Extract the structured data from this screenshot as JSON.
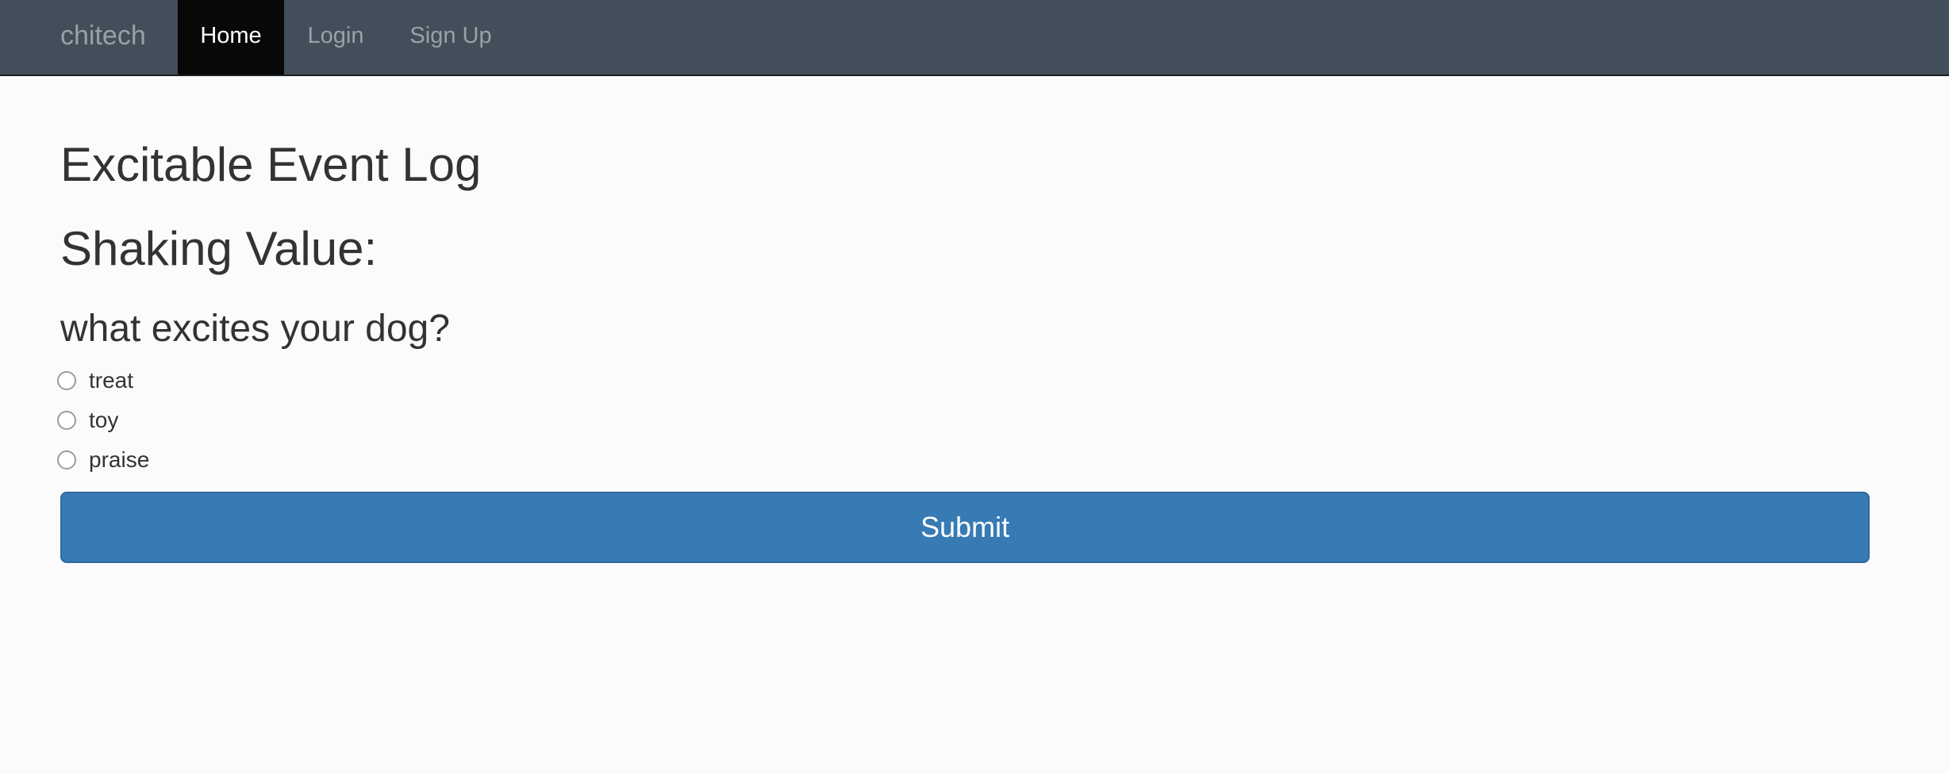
{
  "navbar": {
    "brand": "chitech",
    "items": [
      {
        "label": "Home",
        "active": true
      },
      {
        "label": "Login",
        "active": false
      },
      {
        "label": "Sign Up",
        "active": false
      }
    ]
  },
  "main": {
    "title": "Excitable Event Log",
    "shaking_label": "Shaking Value:",
    "question": "what excites your dog?",
    "options": [
      {
        "label": "treat",
        "checked": false
      },
      {
        "label": "toy",
        "checked": false
      },
      {
        "label": "praise",
        "checked": false
      }
    ],
    "submit_label": "Submit"
  },
  "colors": {
    "navbar_bg": "#424e59",
    "active_nav_bg": "#080808",
    "primary_button": "#377ab4",
    "page_bg": "#fbfbfb"
  }
}
